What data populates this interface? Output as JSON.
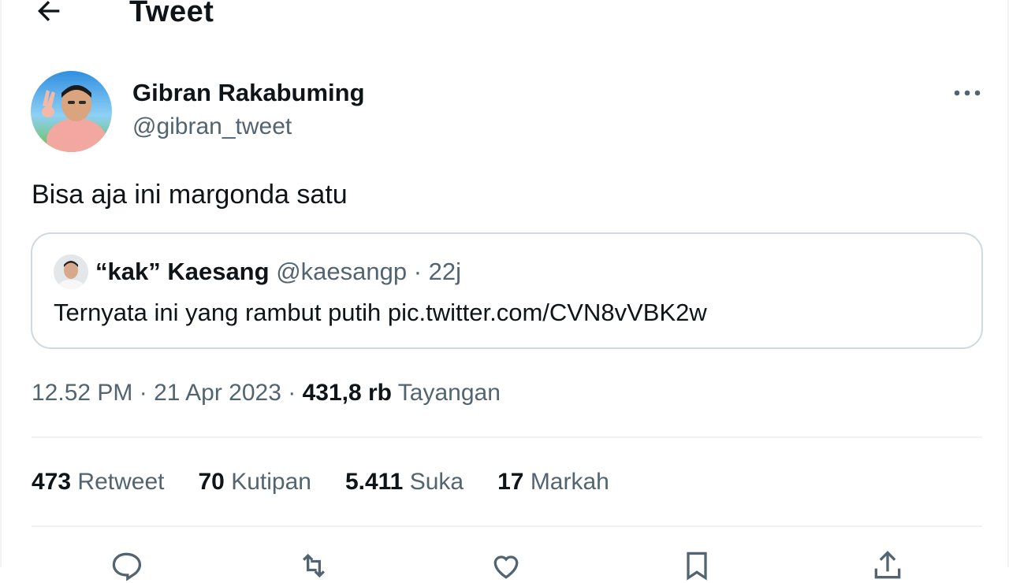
{
  "header": {
    "title": "Tweet",
    "back_icon": "arrow-left-icon"
  },
  "author": {
    "name": "Gibran Rakabuming",
    "handle": "@gibran_tweet",
    "avatar": "avatar-image"
  },
  "tweet": {
    "text": "Bisa aja ini margonda satu"
  },
  "quoted_tweet": {
    "name": "“kak” Kaesang",
    "handle": "@kaesangp",
    "separator": " · ",
    "time": "22j",
    "text": "Ternyata ini yang rambut putih pic.twitter.com/CVN8vVBK2w"
  },
  "meta": {
    "time": "12.52 PM",
    "separator": " · ",
    "date": "21 Apr 2023",
    "views": "431,8 rb",
    "views_label": "Tayangan"
  },
  "stats": [
    {
      "count": "473",
      "label": "Retweet"
    },
    {
      "count": "70",
      "label": "Kutipan"
    },
    {
      "count": "5.411",
      "label": "Suka"
    },
    {
      "count": "17",
      "label": "Markah"
    }
  ],
  "actions": [
    "reply-icon",
    "retweet-icon",
    "like-icon",
    "bookmark-icon",
    "share-icon"
  ],
  "colors": {
    "text": "#0f1419",
    "secondary": "#536471",
    "border": "#cfd9de",
    "divider": "#eff3f4"
  }
}
